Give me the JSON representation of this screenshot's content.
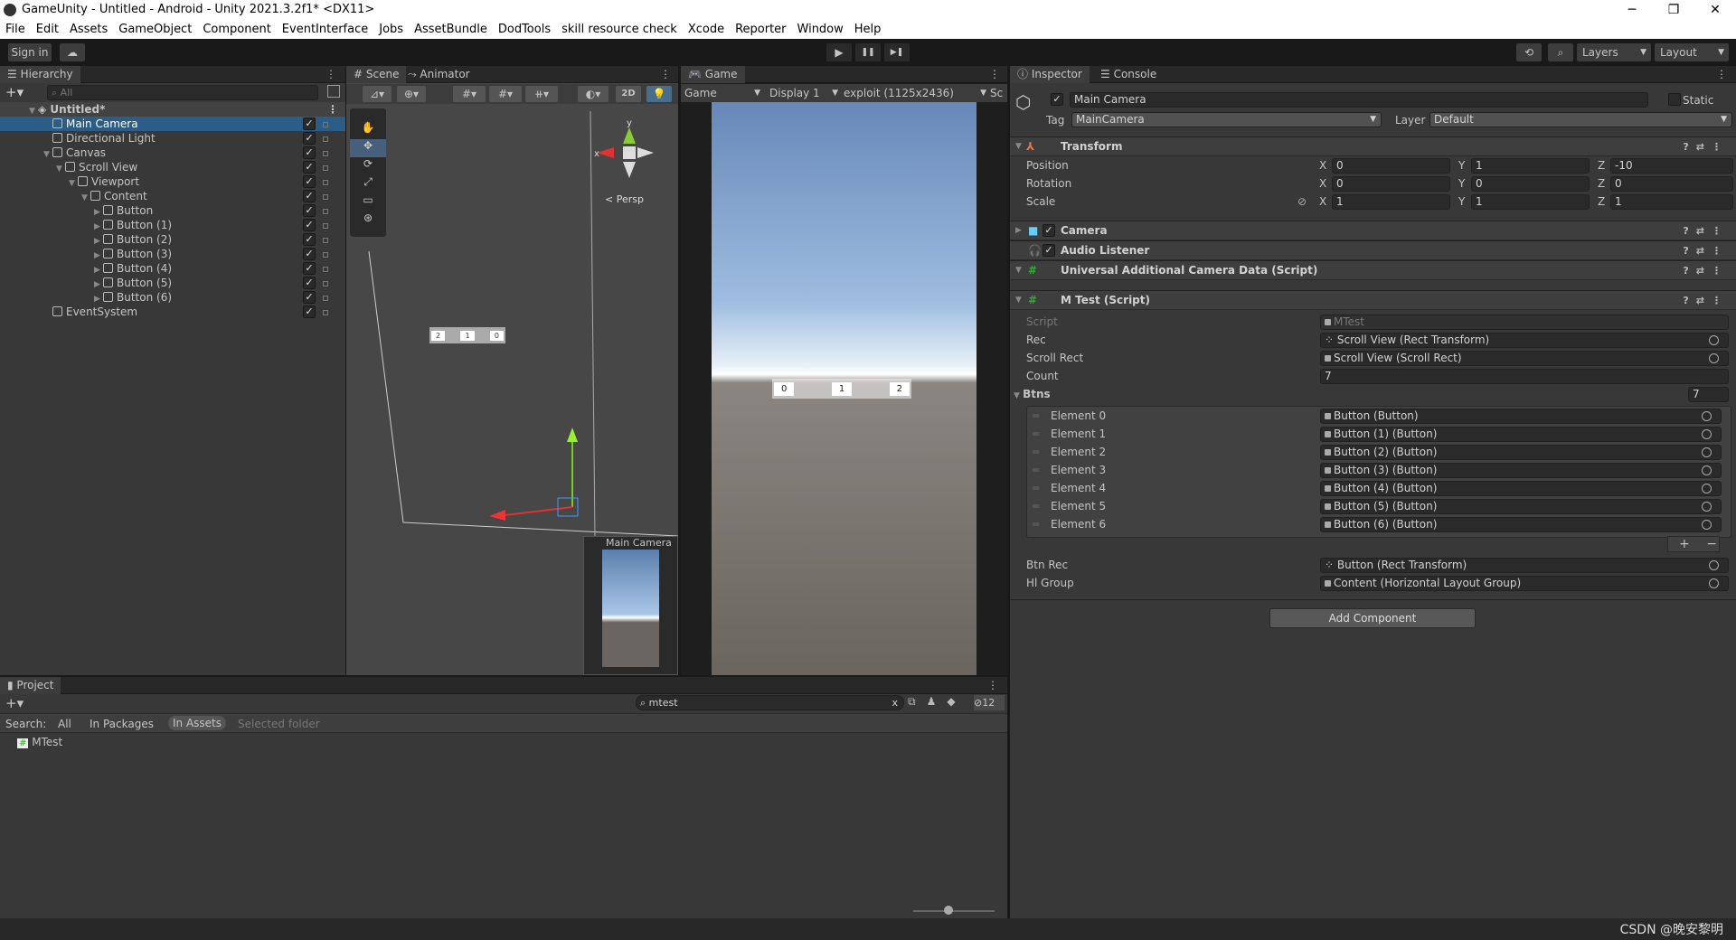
{
  "window": {
    "title": "GameUnity - Untitled - Android - Unity 2021.3.2f1* <DX11>",
    "minimize": "─",
    "maximize": "❐",
    "close": "✕"
  },
  "menu": [
    "File",
    "Edit",
    "Assets",
    "GameObject",
    "Component",
    "EventInterface",
    "Jobs",
    "AssetBundle",
    "DodTools",
    "skill resource check",
    "Xcode",
    "Reporter",
    "Window",
    "Help"
  ],
  "toolbar": {
    "sign_in": "Sign in",
    "layers": "Layers",
    "layout": "Layout",
    "play": "▶",
    "pause": "❚❚",
    "step": "▶❚"
  },
  "hierarchy": {
    "tab": "Hierarchy",
    "search_placeholder": "All",
    "scene": "Untitled*",
    "items": [
      {
        "label": "Main Camera",
        "depth": 1,
        "selected": true
      },
      {
        "label": "Directional Light",
        "depth": 1
      },
      {
        "label": "Canvas",
        "depth": 1,
        "expanded": true
      },
      {
        "label": "Scroll View",
        "depth": 2,
        "expanded": true
      },
      {
        "label": "Viewport",
        "depth": 3,
        "expanded": true
      },
      {
        "label": "Content",
        "depth": 4,
        "expanded": true
      },
      {
        "label": "Button",
        "depth": 5,
        "collapsed": true
      },
      {
        "label": "Button (1)",
        "depth": 5,
        "collapsed": true
      },
      {
        "label": "Button (2)",
        "depth": 5,
        "collapsed": true
      },
      {
        "label": "Button (3)",
        "depth": 5,
        "collapsed": true
      },
      {
        "label": "Button (4)",
        "depth": 5,
        "collapsed": true
      },
      {
        "label": "Button (5)",
        "depth": 5,
        "collapsed": true
      },
      {
        "label": "Button (6)",
        "depth": 5,
        "collapsed": true
      },
      {
        "label": "EventSystem",
        "depth": 1
      }
    ]
  },
  "scene": {
    "tab": "Scene",
    "animator_tab": "Animator",
    "btn_2d": "2D",
    "persp": "Persp",
    "axis_y": "y",
    "axis_x": "x",
    "camera_preview": "Main Camera",
    "buttons": [
      "2",
      "1",
      "0"
    ]
  },
  "game": {
    "tab": "Game",
    "mode": "Game",
    "display": "Display 1",
    "resolution": "exploit (1125x2436)",
    "scale": "Sc",
    "buttons": [
      "0",
      "1",
      "2"
    ]
  },
  "inspector": {
    "tab": "Inspector",
    "console_tab": "Console",
    "object_name": "Main Camera",
    "static": "Static",
    "tag_label": "Tag",
    "tag": "MainCamera",
    "layer_label": "Layer",
    "layer": "Default",
    "transform": {
      "title": "Transform",
      "rows": [
        {
          "label": "Position",
          "x": "0",
          "y": "1",
          "z": "-10"
        },
        {
          "label": "Rotation",
          "x": "0",
          "y": "0",
          "z": "0"
        },
        {
          "label": "Scale",
          "x": "1",
          "y": "1",
          "z": "1"
        }
      ]
    },
    "components": [
      "Camera",
      "Audio Listener",
      "Universal Additional Camera Data (Script)"
    ],
    "mtest": {
      "title": "M Test (Script)",
      "script_label": "Script",
      "script": "MTest",
      "rec_label": "Rec",
      "rec": "Scroll View (Rect Transform)",
      "scroll_rect_label": "Scroll Rect",
      "scroll_rect": "Scroll View (Scroll Rect)",
      "count_label": "Count",
      "count": "7",
      "btns_label": "Btns",
      "btns_size": "7",
      "elements": [
        {
          "label": "Element 0",
          "value": "Button (Button)"
        },
        {
          "label": "Element 1",
          "value": "Button (1) (Button)"
        },
        {
          "label": "Element 2",
          "value": "Button (2) (Button)"
        },
        {
          "label": "Element 3",
          "value": "Button (3) (Button)"
        },
        {
          "label": "Element 4",
          "value": "Button (4) (Button)"
        },
        {
          "label": "Element 5",
          "value": "Button (5) (Button)"
        },
        {
          "label": "Element 6",
          "value": "Button (6) (Button)"
        }
      ],
      "plus": "+",
      "minus": "−",
      "btn_rec_label": "Btn Rec",
      "btn_rec": "Button (Rect Transform)",
      "hl_group_label": "Hl Group",
      "hl_group": "Content (Horizontal Layout Group)"
    },
    "add_component": "Add Component"
  },
  "project": {
    "tab": "Project",
    "search_value": "mtest",
    "search_label": "Search:",
    "filters": [
      "All",
      "In Packages",
      "In Assets",
      "Selected folder"
    ],
    "active_filter": "In Assets",
    "hidden_count": "12",
    "results": [
      "MTest"
    ]
  },
  "watermark": "CSDN @晚安黎明"
}
